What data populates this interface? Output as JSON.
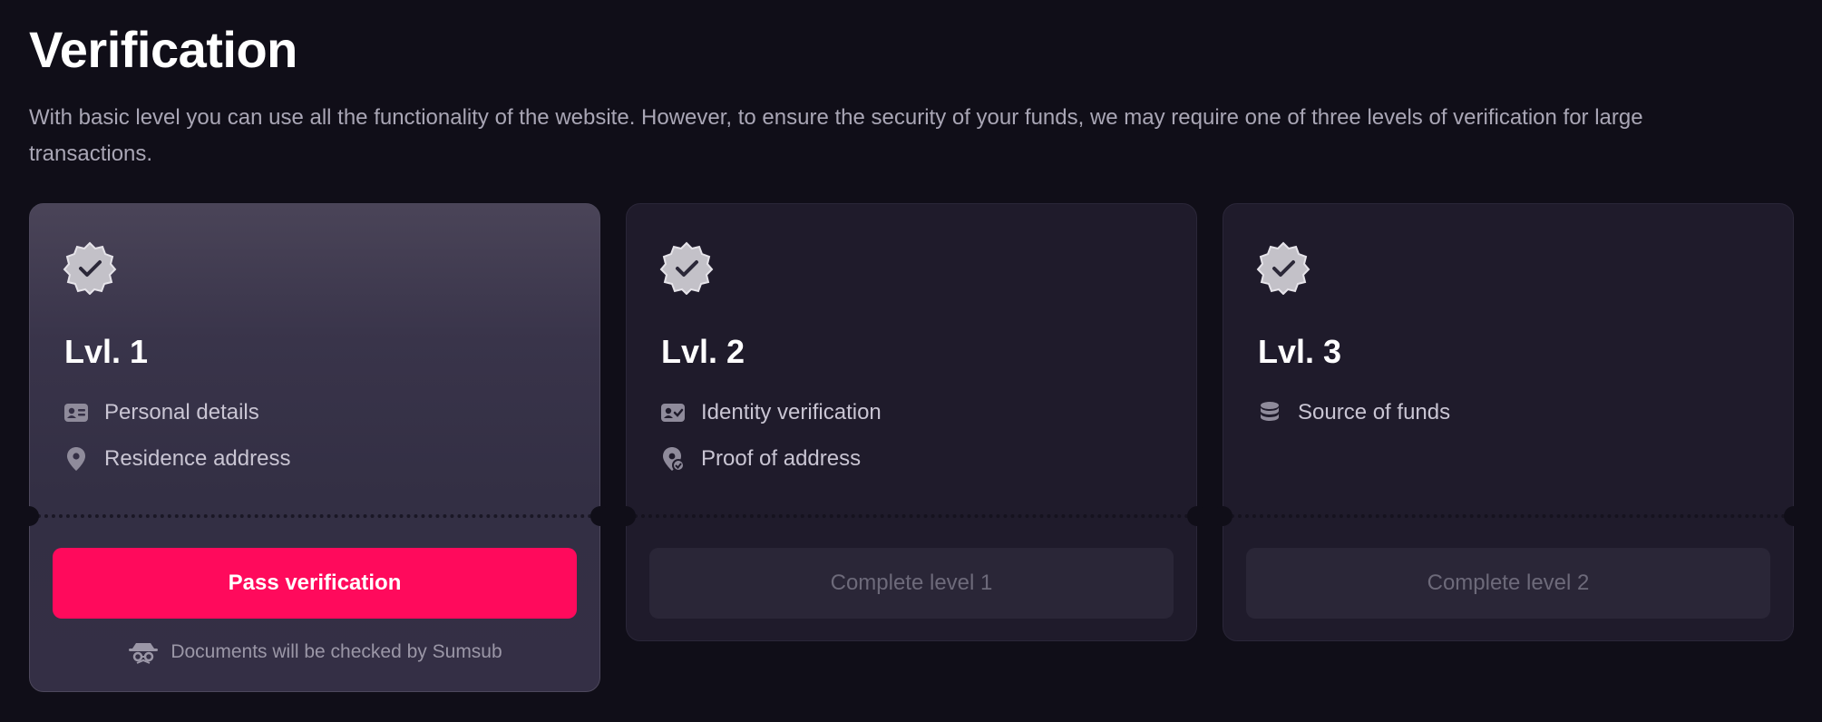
{
  "header": {
    "title": "Verification",
    "description": "With basic level you can use all the functionality of the website. However, to ensure the security of your funds, we may require one of three levels of verification for large transactions."
  },
  "levels": [
    {
      "label": "Lvl. 1",
      "requirements": [
        {
          "icon": "id-card-icon",
          "text": "Personal details"
        },
        {
          "icon": "location-pin-icon",
          "text": "Residence address"
        }
      ],
      "button": "Pass verification",
      "note": "Documents will be checked by Sumsub",
      "note_icon": "sumsub-icon"
    },
    {
      "label": "Lvl. 2",
      "requirements": [
        {
          "icon": "id-check-icon",
          "text": "Identity verification"
        },
        {
          "icon": "address-proof-icon",
          "text": "Proof of address"
        }
      ],
      "button": "Complete level 1"
    },
    {
      "label": "Lvl. 3",
      "requirements": [
        {
          "icon": "coins-stack-icon",
          "text": "Source of funds"
        }
      ],
      "button": "Complete level 2"
    }
  ],
  "colors": {
    "background": "#100e18",
    "card": "#1f1b2b",
    "accent": "#ff0a5c",
    "text_muted": "#a9a6b5"
  }
}
